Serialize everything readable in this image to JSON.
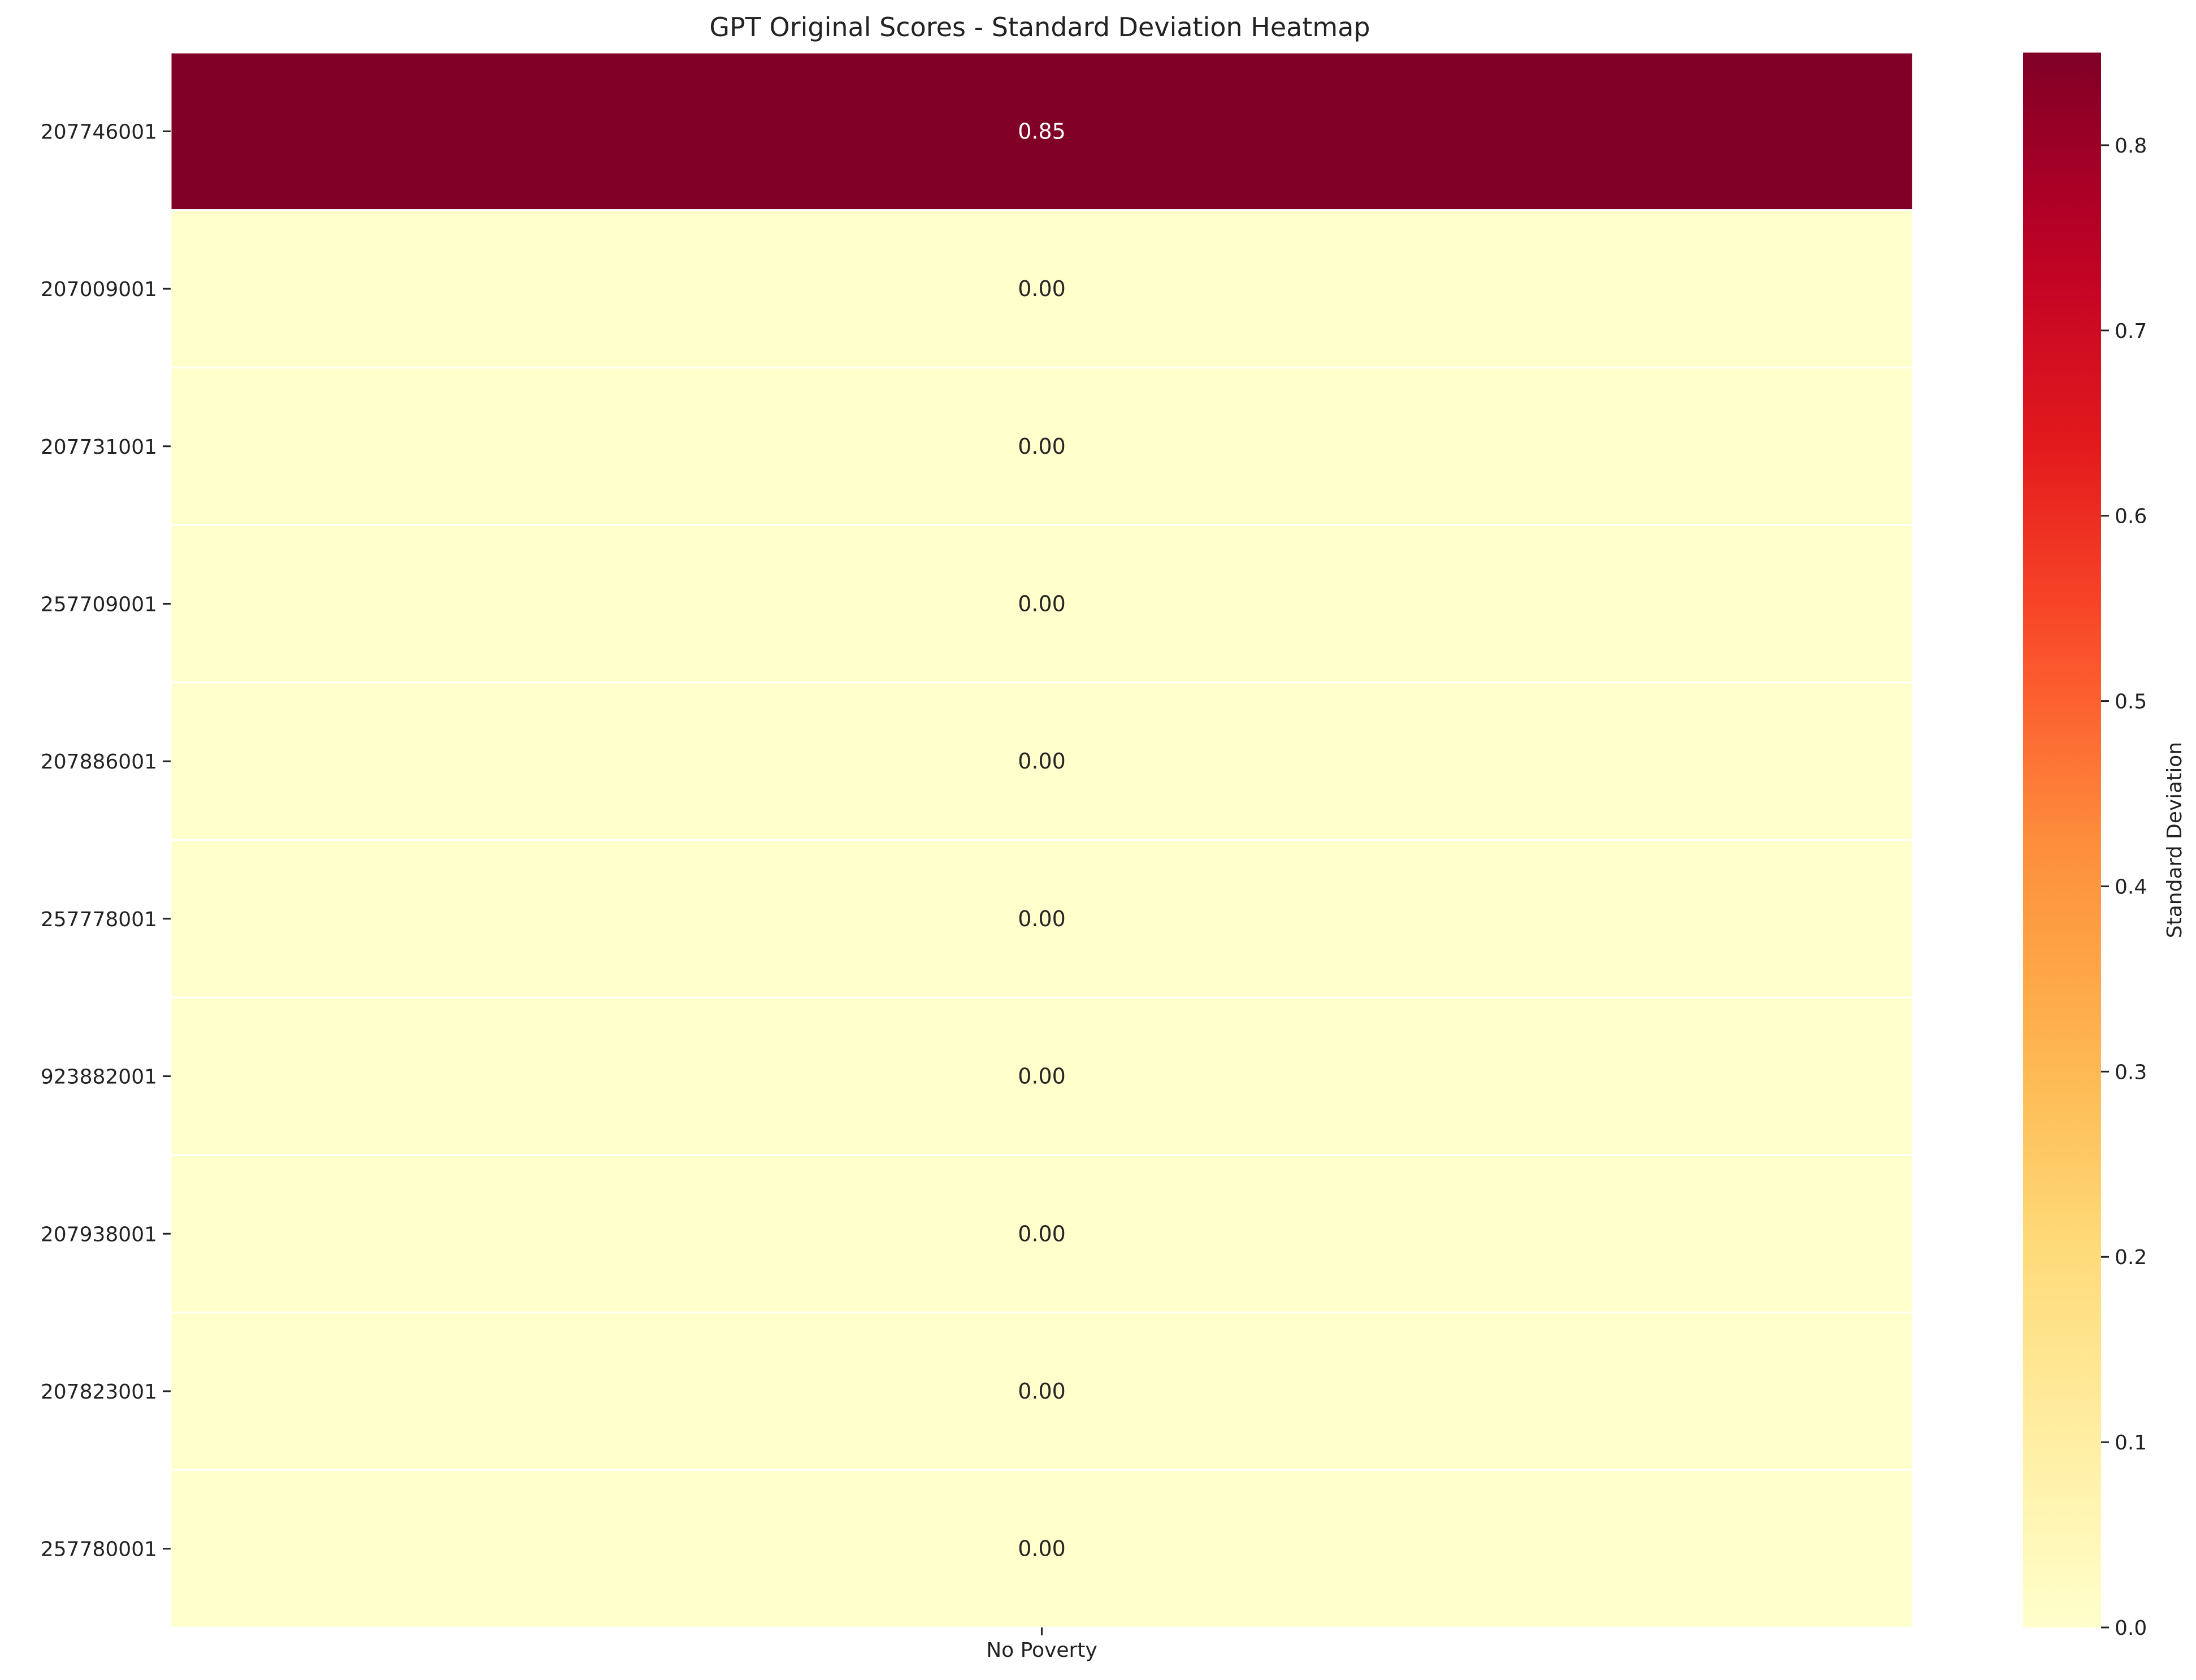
{
  "chart_data": {
    "type": "heatmap",
    "title": "GPT Original Scores - Standard Deviation Heatmap",
    "xlabel": "",
    "ylabel": "",
    "columns": [
      "No Poverty"
    ],
    "rows": [
      "207746001",
      "207009001",
      "207731001",
      "257709001",
      "207886001",
      "257778001",
      "923882001",
      "207938001",
      "207823001",
      "257780001"
    ],
    "values": [
      [
        0.85
      ],
      [
        0.0
      ],
      [
        0.0
      ],
      [
        0.0
      ],
      [
        0.0
      ],
      [
        0.0
      ],
      [
        0.0
      ],
      [
        0.0
      ],
      [
        0.0
      ],
      [
        0.0
      ]
    ],
    "value_labels": [
      [
        "0.85"
      ],
      [
        "0.00"
      ],
      [
        "0.00"
      ],
      [
        "0.00"
      ],
      [
        "0.00"
      ],
      [
        "0.00"
      ],
      [
        "0.00"
      ],
      [
        "0.00"
      ],
      [
        "0.00"
      ],
      [
        "0.00"
      ]
    ],
    "colormap": "YlOrRd",
    "colorbar": {
      "label": "Standard Deviation",
      "range": [
        0.0,
        0.85
      ],
      "ticks": [
        0.0,
        0.1,
        0.2,
        0.3,
        0.4,
        0.5,
        0.6,
        0.7,
        0.8
      ],
      "tick_labels": [
        "0.0",
        "0.1",
        "0.2",
        "0.3",
        "0.4",
        "0.5",
        "0.6",
        "0.7",
        "0.8"
      ]
    },
    "cell_separator_color": "#ffffff"
  }
}
